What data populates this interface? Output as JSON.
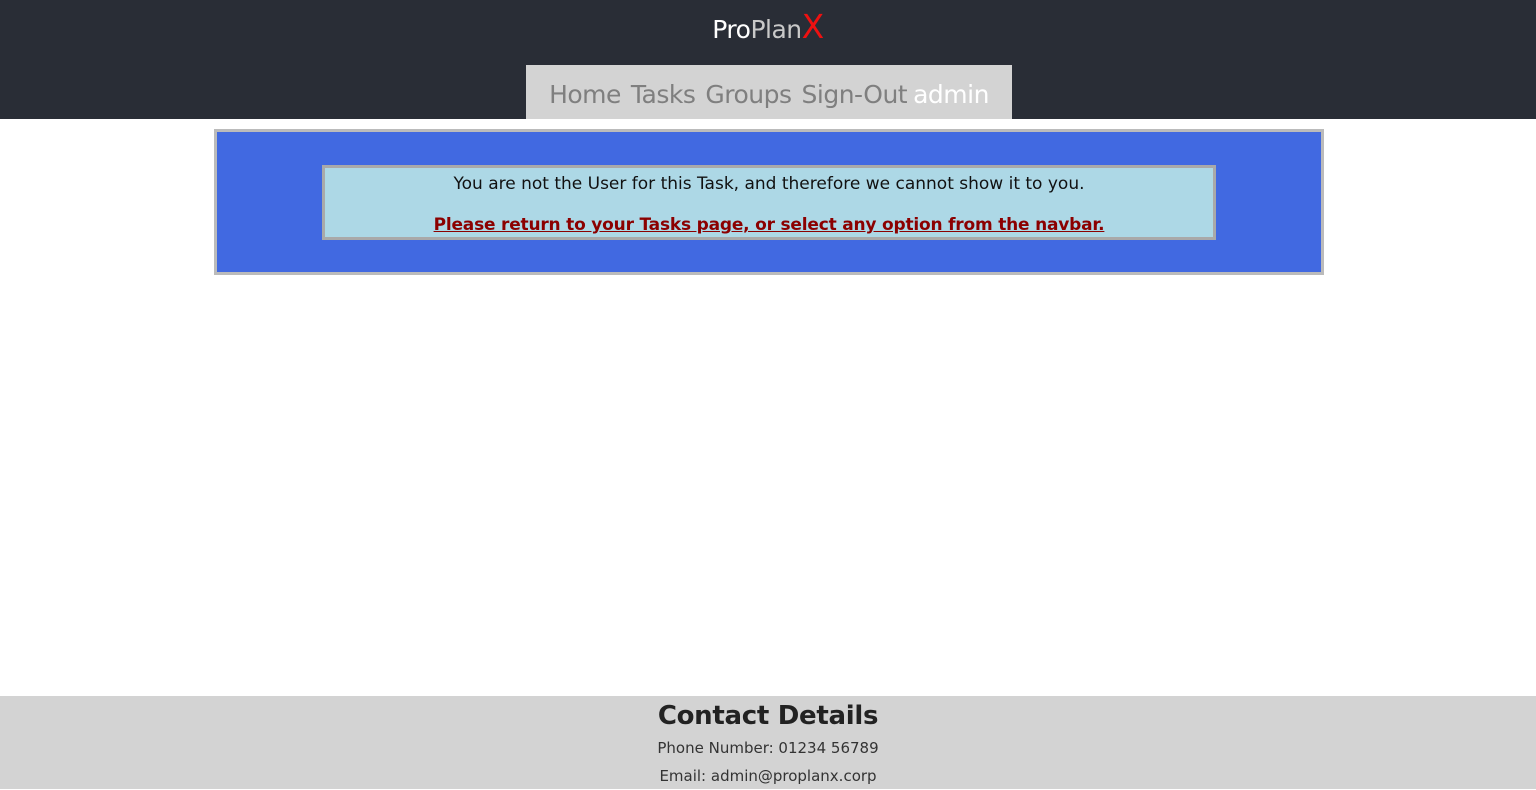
{
  "brand": {
    "part1": "Pro",
    "part2": "Plan",
    "part3": "X"
  },
  "navbar": {
    "items": [
      {
        "label": "Home"
      },
      {
        "label": "Tasks"
      },
      {
        "label": "Groups"
      },
      {
        "label": "Sign-Out"
      }
    ],
    "user": "admin"
  },
  "notice": {
    "message": "You are not the User for this Task, and therefore we cannot show it to you.",
    "link_text": "Please return to your Tasks page, or select any option from the navbar."
  },
  "footer": {
    "title": "Contact Details",
    "phone": "Phone Number: 01234 56789",
    "email": "Email: admin@proplanx.corp"
  },
  "colors": {
    "header_bg": "#292d36",
    "navbar_bg": "#d3d3d3",
    "notice_outer_bg": "#4169e1",
    "notice_inner_bg": "#add8e6",
    "link_color": "#8b0000",
    "footer_bg": "#d3d3d3",
    "brand_x": "#ee1111"
  }
}
